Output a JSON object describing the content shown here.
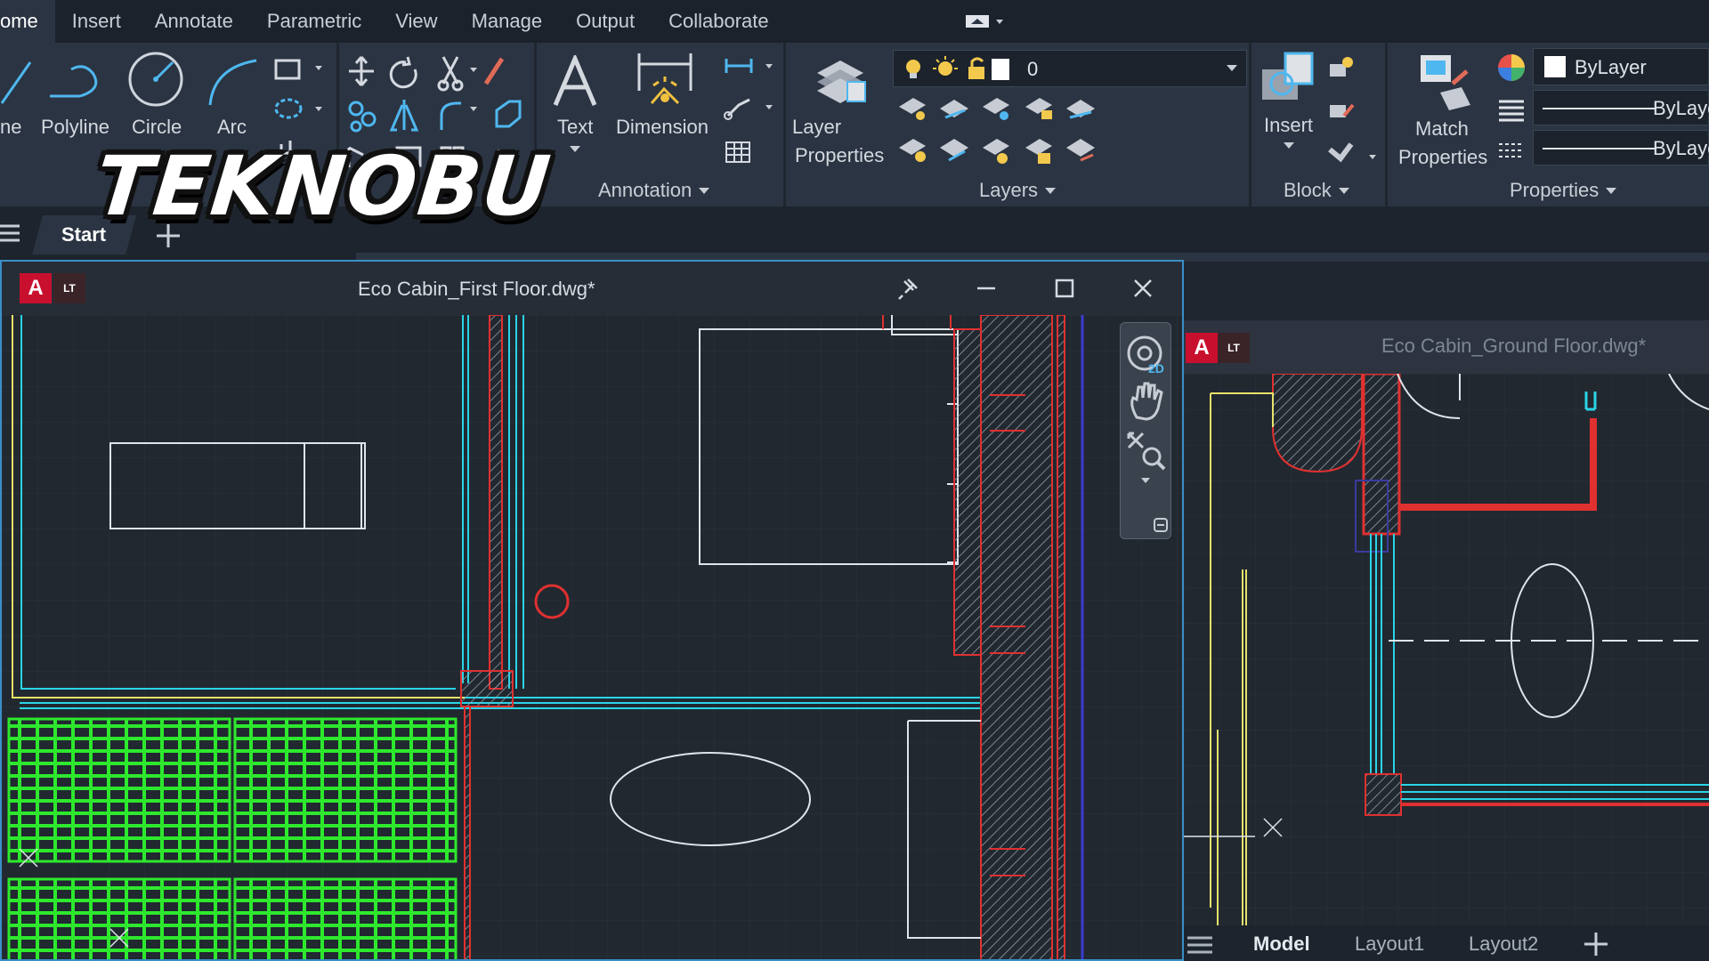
{
  "ribbon": {
    "tabs": [
      {
        "label": "Home",
        "shown": "ome",
        "active": true
      },
      {
        "label": "Insert"
      },
      {
        "label": "Annotate"
      },
      {
        "label": "Parametric"
      },
      {
        "label": "View"
      },
      {
        "label": "Manage"
      },
      {
        "label": "Output"
      },
      {
        "label": "Collaborate"
      }
    ],
    "draw": {
      "line": "ne",
      "polyline": "Polyline",
      "circle": "Circle",
      "arc": "Arc"
    },
    "annotation": {
      "text": "Text",
      "dimension": "Dimension",
      "panel_title": "Annotation"
    },
    "layers": {
      "layer_properties_1": "Layer",
      "layer_properties_2": "Properties",
      "current_layer": "0",
      "panel_title": "Layers"
    },
    "block": {
      "insert": "Insert",
      "panel_title": "Block"
    },
    "properties": {
      "match_1": "Match",
      "match_2": "Properties",
      "color": "ByLayer",
      "lineweight": "ByLaye",
      "linetype": "ByLaye",
      "panel_title": "Properties"
    }
  },
  "file_tabs": {
    "start": "Start"
  },
  "window_main": {
    "title": "Eco Cabin_First Floor.dwg*",
    "logo": "A",
    "badge": "LT"
  },
  "window_ground": {
    "title": "Eco Cabin_Ground Floor.dwg*",
    "logo": "A",
    "badge": "LT"
  },
  "layout_tabs": {
    "model": "Model",
    "layout1": "Layout1",
    "layout2": "Layout2"
  },
  "navbar": {
    "badge": "2D"
  },
  "watermark": "TEKNOBU",
  "colors": {
    "accent": "#3a8fc7",
    "autocad_red": "#c8102e",
    "cad_green": "#2ee82e",
    "cad_cyan": "#2ad4e6",
    "cad_yellow": "#e6e26a"
  }
}
